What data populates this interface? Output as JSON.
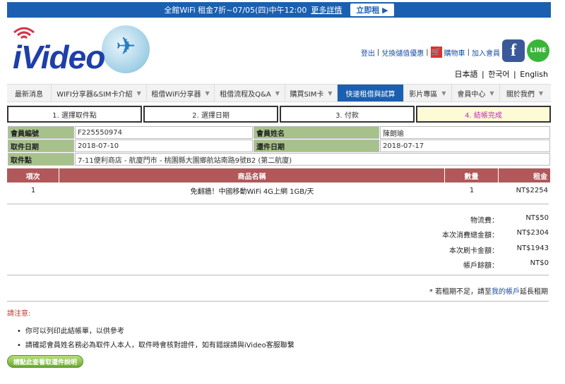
{
  "promo": {
    "text": "全館WiFi 租金7折~07/05(四)中午12:00",
    "more": "更多詳情",
    "buy": "立即租"
  },
  "brand": {
    "logo_text": "iVideo"
  },
  "toplinks": {
    "logout": "登出",
    "redeem": "兌換儲值優惠",
    "cart": "購物車",
    "join": "加入會員"
  },
  "social": {
    "facebook": "f",
    "line": "LINE"
  },
  "langs": [
    "日本語",
    "한국어",
    "English"
  ],
  "nav": [
    {
      "label": "最新消息",
      "caret": false
    },
    {
      "label": "WIFI分享器&SIM卡介紹",
      "caret": true
    },
    {
      "label": "租借WiFi分享器",
      "caret": true
    },
    {
      "label": "租借流程及Q&A",
      "caret": true
    },
    {
      "label": "購買SIM卡",
      "caret": true
    },
    {
      "label": "快速租借與試算",
      "caret": false,
      "active": true
    },
    {
      "label": "影片專區",
      "caret": true
    },
    {
      "label": "會員中心",
      "caret": true
    },
    {
      "label": "關於我們",
      "caret": true
    }
  ],
  "steps": [
    "1. 選擇取件點",
    "2. 選擇日期",
    "3. 付款",
    "4. 結帳完成"
  ],
  "info": {
    "member_id_label": "會員編號",
    "member_id": "F225550974",
    "member_name_label": "會員姓名",
    "member_name": "陳朗瑜",
    "pickup_date_label": "取件日期",
    "pickup_date": "2018-07-10",
    "return_date_label": "還件日期",
    "return_date": "2018-07-17",
    "pickup_point_label": "取件點",
    "pickup_point": "7-11便利商店 - 航廈門市 - 桃園縣大園鄉航站南路9號B2 (第二航廈)"
  },
  "goods": {
    "headers": {
      "no": "項次",
      "name": "商品名稱",
      "qty": "數量",
      "rent": "租金"
    },
    "rows": [
      {
        "no": "1",
        "name": "免翻牆！中國移動WiFi 4G上網 1GB/天",
        "qty": "1",
        "rent": "NT$2254"
      }
    ]
  },
  "summary": [
    {
      "label": "物流費：",
      "value": "NT$50"
    },
    {
      "label": "本次消費總金額：",
      "value": "NT$2304"
    },
    {
      "label": "本次刷卡金額：",
      "value": "NT$1943"
    },
    {
      "label": "帳戶餘額：",
      "value": "NT$0"
    }
  ],
  "note": {
    "prefix": "* 若租期不足，請至",
    "link": "我的帳戶",
    "suffix": "延長租期"
  },
  "attention": "請注意:",
  "bullets": [
    "你可以列印此結帳單，以供參考",
    "請確認會員姓名務必為取件人本人，取件時會核對證件，如有錯誤請與iVideo客服聯繫"
  ],
  "pick_button": "請點此查看取還件說明"
}
